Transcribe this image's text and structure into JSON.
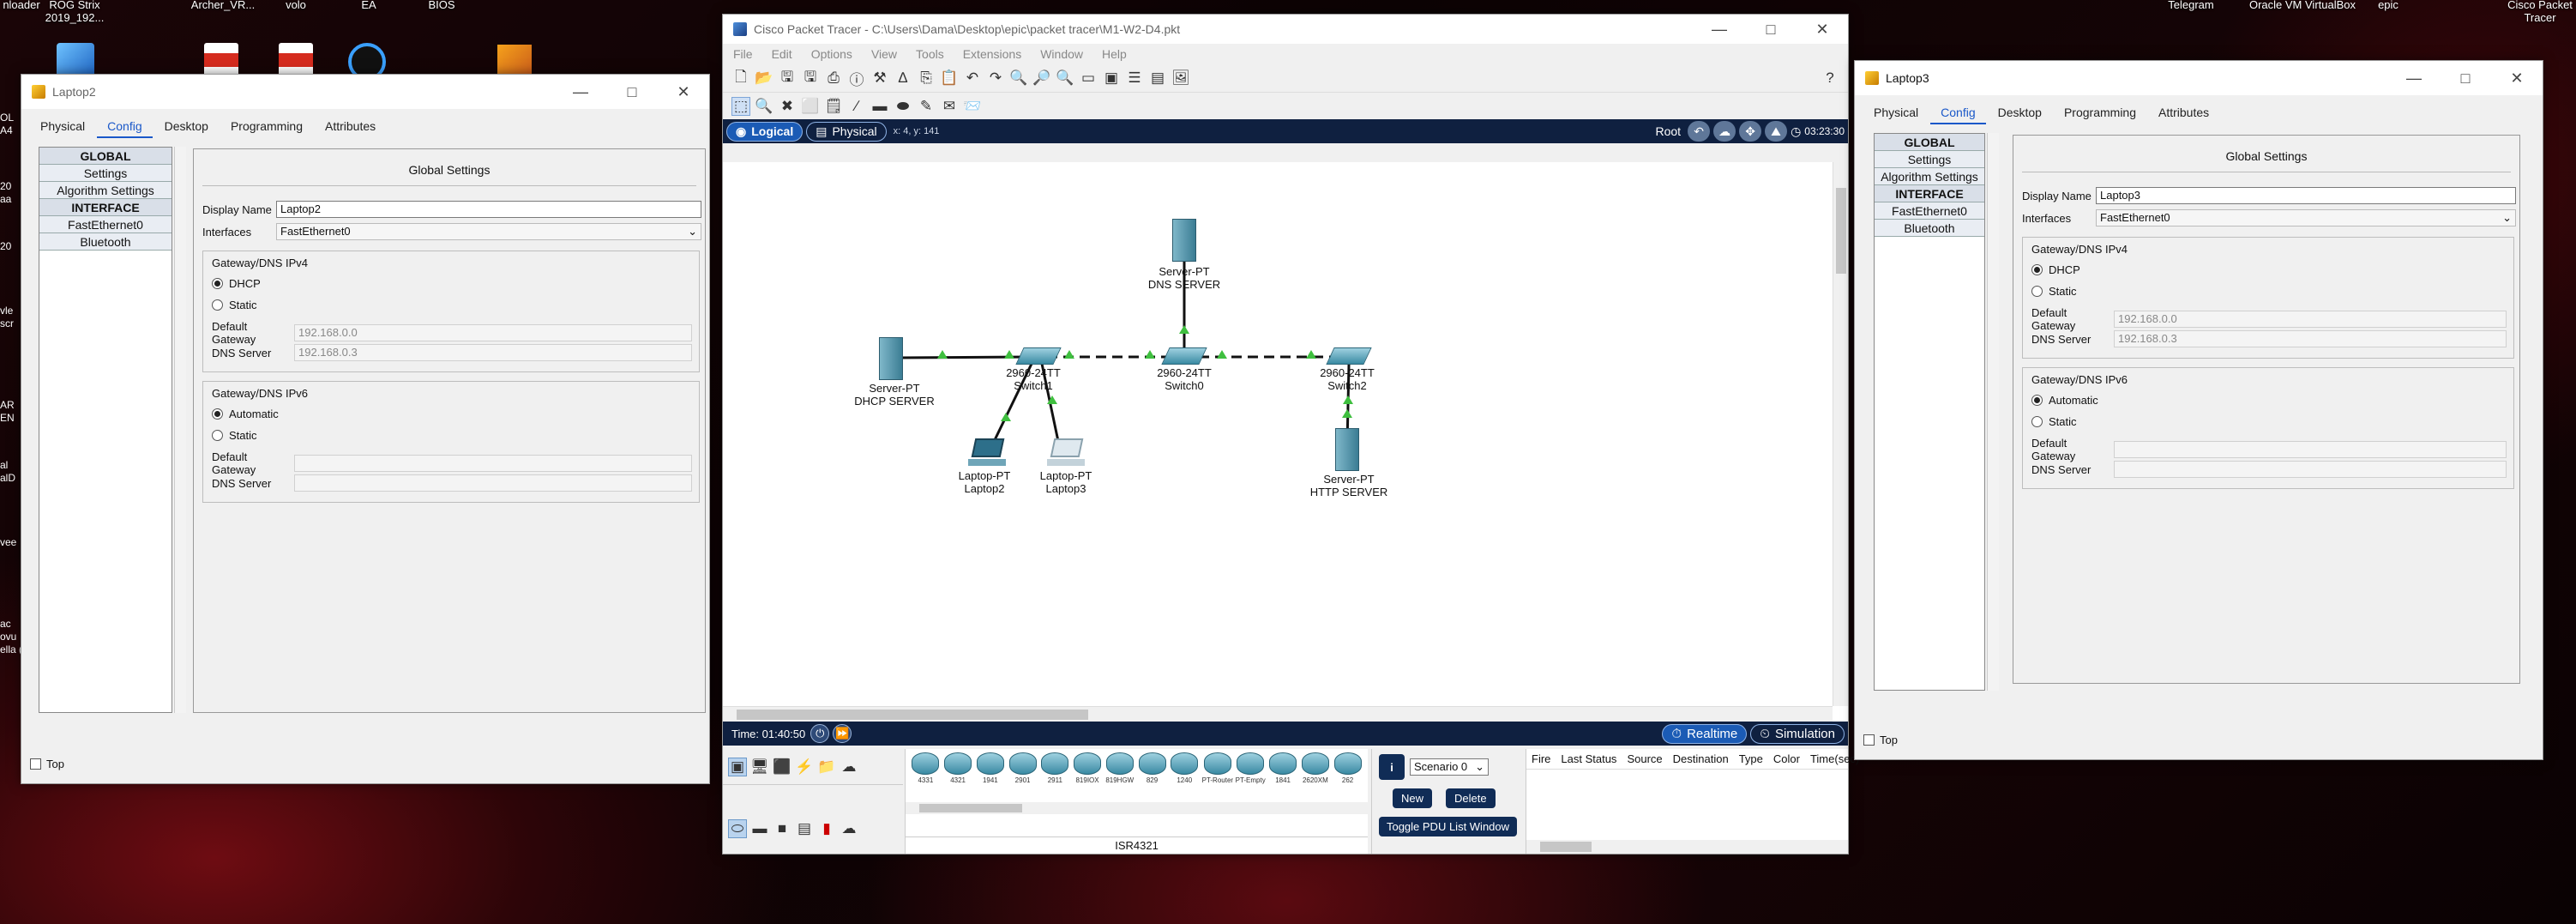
{
  "desktop": {
    "top_left_labels": [
      "nloader",
      "ROG Strix",
      "2019_192...",
      "Archer_VR...",
      "volo",
      "EA",
      "BIOS"
    ],
    "left_edge_labels": [
      "OL",
      "A4",
      "20",
      "aa",
      "20",
      "vle",
      "scr",
      "AR",
      "EN",
      "al",
      "alD",
      "vee",
      "ac",
      "ovu",
      "ella (2)"
    ],
    "top_right_labels": [
      "Telegram",
      "Oracle VM VirtualBox",
      "epic",
      "Cisco Packet Tracer"
    ]
  },
  "laptop2": {
    "title": "Laptop2",
    "tabs": [
      "Physical",
      "Config",
      "Desktop",
      "Programming",
      "Attributes"
    ],
    "active_tab": "Config",
    "side_items": [
      {
        "label": "GLOBAL",
        "header": true
      },
      {
        "label": "Settings",
        "header": false
      },
      {
        "label": "Algorithm Settings",
        "header": false
      },
      {
        "label": "INTERFACE",
        "header": true
      },
      {
        "label": "FastEthernet0",
        "header": false
      },
      {
        "label": "Bluetooth",
        "header": false
      }
    ],
    "heading": "Global Settings",
    "display_name_label": "Display Name",
    "display_name": "Laptop2",
    "interfaces_label": "Interfaces",
    "interface": "FastEthernet0",
    "ipv4_caption": "Gateway/DNS IPv4",
    "dhcp_label": "DHCP",
    "static_label": "Static",
    "gateway_label": "Default Gateway",
    "gateway_value": "192.168.0.0",
    "dns_label": "DNS Server",
    "dns_value": "192.168.0.3",
    "ipv6_caption": "Gateway/DNS IPv6",
    "automatic_label": "Automatic",
    "static6_label": "Static",
    "gateway6_label": "Default Gateway",
    "dns6_label": "DNS Server",
    "top_label": "Top"
  },
  "laptop3": {
    "title": "Laptop3",
    "tabs": [
      "Physical",
      "Config",
      "Desktop",
      "Programming",
      "Attributes"
    ],
    "active_tab": "Config",
    "side_items": [
      {
        "label": "GLOBAL",
        "header": true
      },
      {
        "label": "Settings",
        "header": false
      },
      {
        "label": "Algorithm Settings",
        "header": false
      },
      {
        "label": "INTERFACE",
        "header": true
      },
      {
        "label": "FastEthernet0",
        "header": false
      },
      {
        "label": "Bluetooth",
        "header": false
      }
    ],
    "heading": "Global Settings",
    "display_name_label": "Display Name",
    "display_name": "Laptop3",
    "interfaces_label": "Interfaces",
    "interface": "FastEthernet0",
    "ipv4_caption": "Gateway/DNS IPv4",
    "dhcp_label": "DHCP",
    "static_label": "Static",
    "gateway_label": "Default Gateway",
    "gateway_value": "192.168.0.0",
    "dns_label": "DNS Server",
    "dns_value": "192.168.0.3",
    "ipv6_caption": "Gateway/DNS IPv6",
    "automatic_label": "Automatic",
    "static6_label": "Static",
    "gateway6_label": "Default Gateway",
    "dns6_label": "DNS Server",
    "top_label": "Top"
  },
  "pt": {
    "title": "Cisco Packet Tracer - C:\\Users\\Dama\\Desktop\\epic\\packet tracer\\M1-W2-D4.pkt",
    "menu": [
      "File",
      "Edit",
      "Options",
      "View",
      "Tools",
      "Extensions",
      "Window",
      "Help"
    ],
    "logical_label": "Logical",
    "physical_label": "Physical",
    "coords": "x: 4, y: 141",
    "root_label": "Root",
    "clock": "03:23:30",
    "time_label": "Time: 01:40:50",
    "realtime_label": "Realtime",
    "simulation_label": "Simulation",
    "device_models": [
      "4331",
      "4321",
      "1941",
      "2901",
      "2911",
      "819IOX",
      "819HGW",
      "829",
      "1240",
      "PT-Router",
      "PT-Empty",
      "1841",
      "2620XM",
      "262"
    ],
    "selected_model": "ISR4321",
    "scenario": "Scenario 0",
    "new_label": "New",
    "delete_label": "Delete",
    "toggle_label": "Toggle PDU List Window",
    "pdu_columns": [
      "Fire",
      "Last Status",
      "Source",
      "Destination",
      "Type",
      "Color",
      "Time(sec)"
    ],
    "devices": [
      {
        "type": "Server-PT",
        "name": "DNS SERVER"
      },
      {
        "type": "Server-PT",
        "name": "DHCP SERVER"
      },
      {
        "type": "2960-24TT",
        "name": "Switch1"
      },
      {
        "type": "2960-24TT",
        "name": "Switch0"
      },
      {
        "type": "2960-24TT",
        "name": "Switch2"
      },
      {
        "type": "Laptop-PT",
        "name": "Laptop2"
      },
      {
        "type": "Laptop-PT",
        "name": "Laptop3"
      },
      {
        "type": "Server-PT",
        "name": "HTTP SERVER"
      }
    ]
  },
  "colors": {
    "accent": "#1a58c9",
    "pt_bar": "#0f2040",
    "link_up": "#3fbf3f"
  }
}
